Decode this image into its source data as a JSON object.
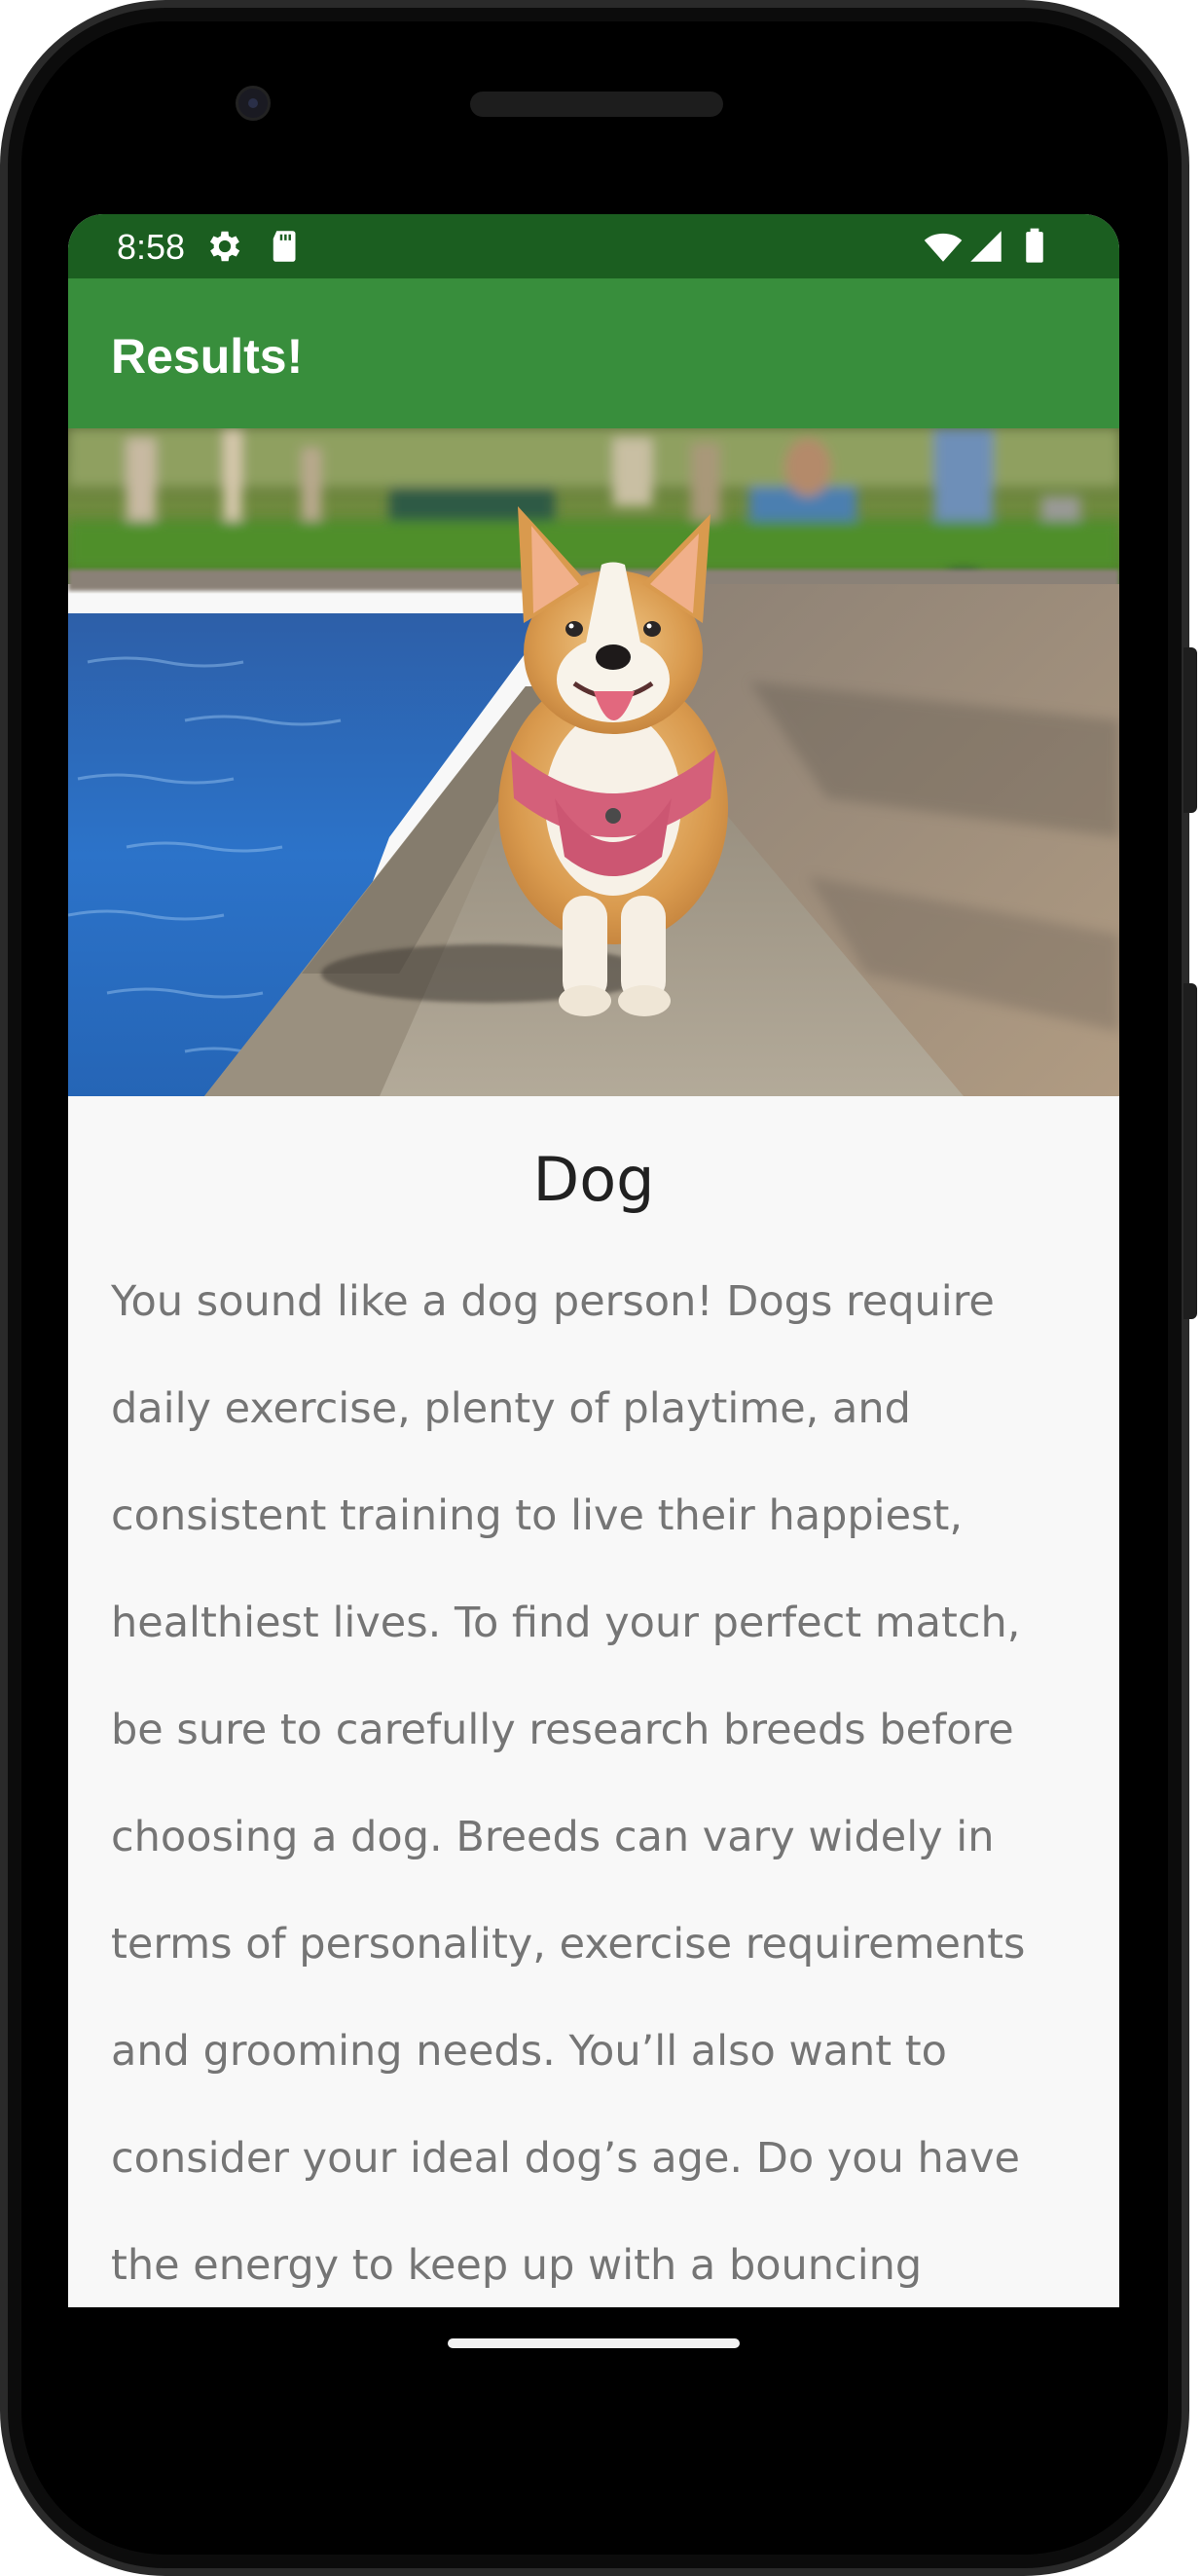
{
  "status_bar": {
    "time": "8:58",
    "icons_left": [
      "settings-icon",
      "sd-card-icon"
    ],
    "icons_right": [
      "wifi-icon",
      "signal-icon",
      "battery-icon"
    ],
    "color": "#1b5e20"
  },
  "app_bar": {
    "title": "Results!",
    "color": "#388e3c"
  },
  "result": {
    "image": "corgi-photo",
    "title": "Dog",
    "description": "You sound like a dog person! Dogs require daily exercise, plenty of playtime, and consistent training to live their happiest, healthiest lives. To find your perfect match, be sure to carefully research breeds before choosing a dog. Breeds can vary widely in terms of personality, exercise requirements and grooming needs. You’ll also want to consider your ideal dog’s age. Do you have the energy to keep up with a bouncing"
  },
  "navigation": {
    "home_indicator": "home-gesture-bar"
  }
}
